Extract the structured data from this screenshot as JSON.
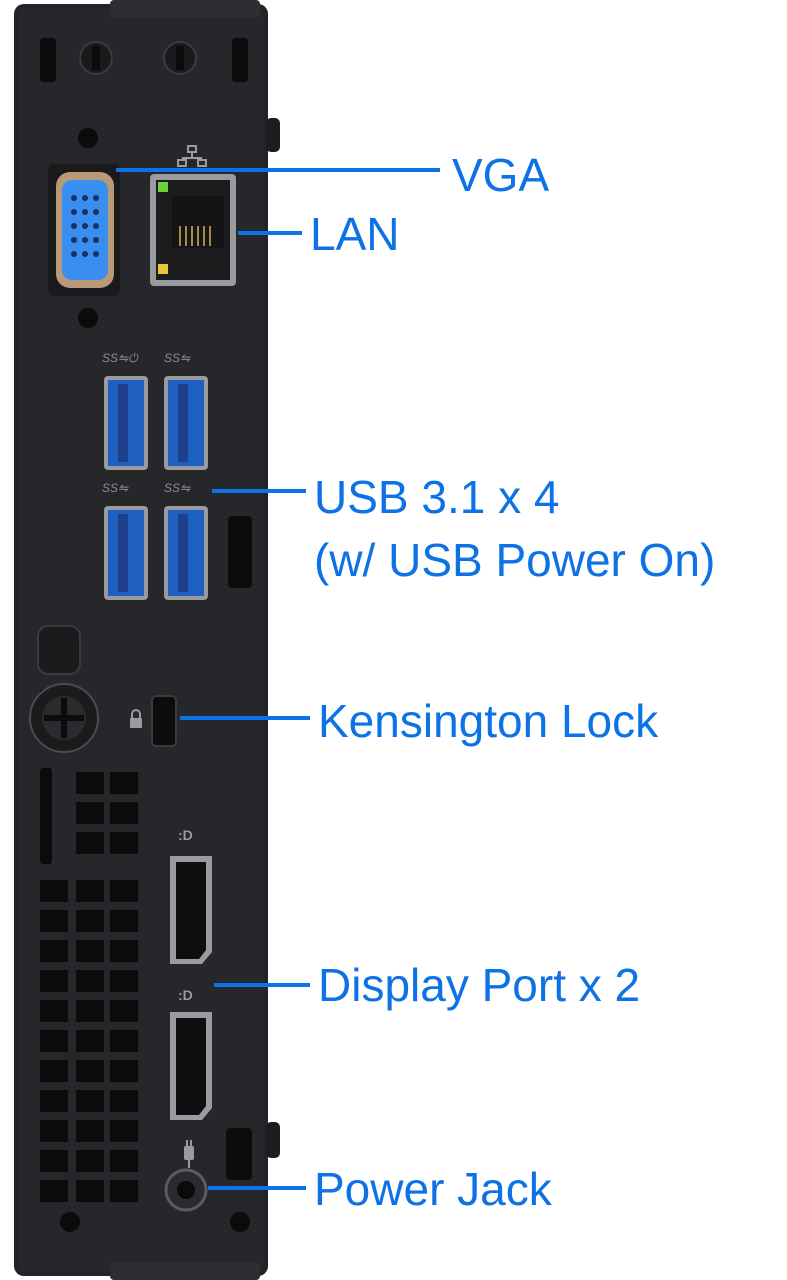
{
  "colors": {
    "accent": "#0d72e6",
    "chassis": "#222326",
    "usb_blue": "#1f5fbf",
    "vga_blue": "#3a8ef0"
  },
  "port_icons": {
    "lan": "network-icon",
    "usb_row1": [
      "usb-ss-power-icon",
      "usb-ss-icon"
    ],
    "usb_row2": [
      "usb-ss-icon",
      "usb-ss-icon"
    ],
    "lock": "padlock-icon",
    "display_port": "displayport-icon",
    "power": "power-plug-icon"
  },
  "labels": {
    "vga": "VGA",
    "lan": "LAN",
    "usb_line1": "USB 3.1 x 4",
    "usb_line2": "(w/ USB Power On)",
    "kensington": "Kensington Lock",
    "display_port": "Display Port x 2",
    "power_jack": "Power Jack"
  }
}
